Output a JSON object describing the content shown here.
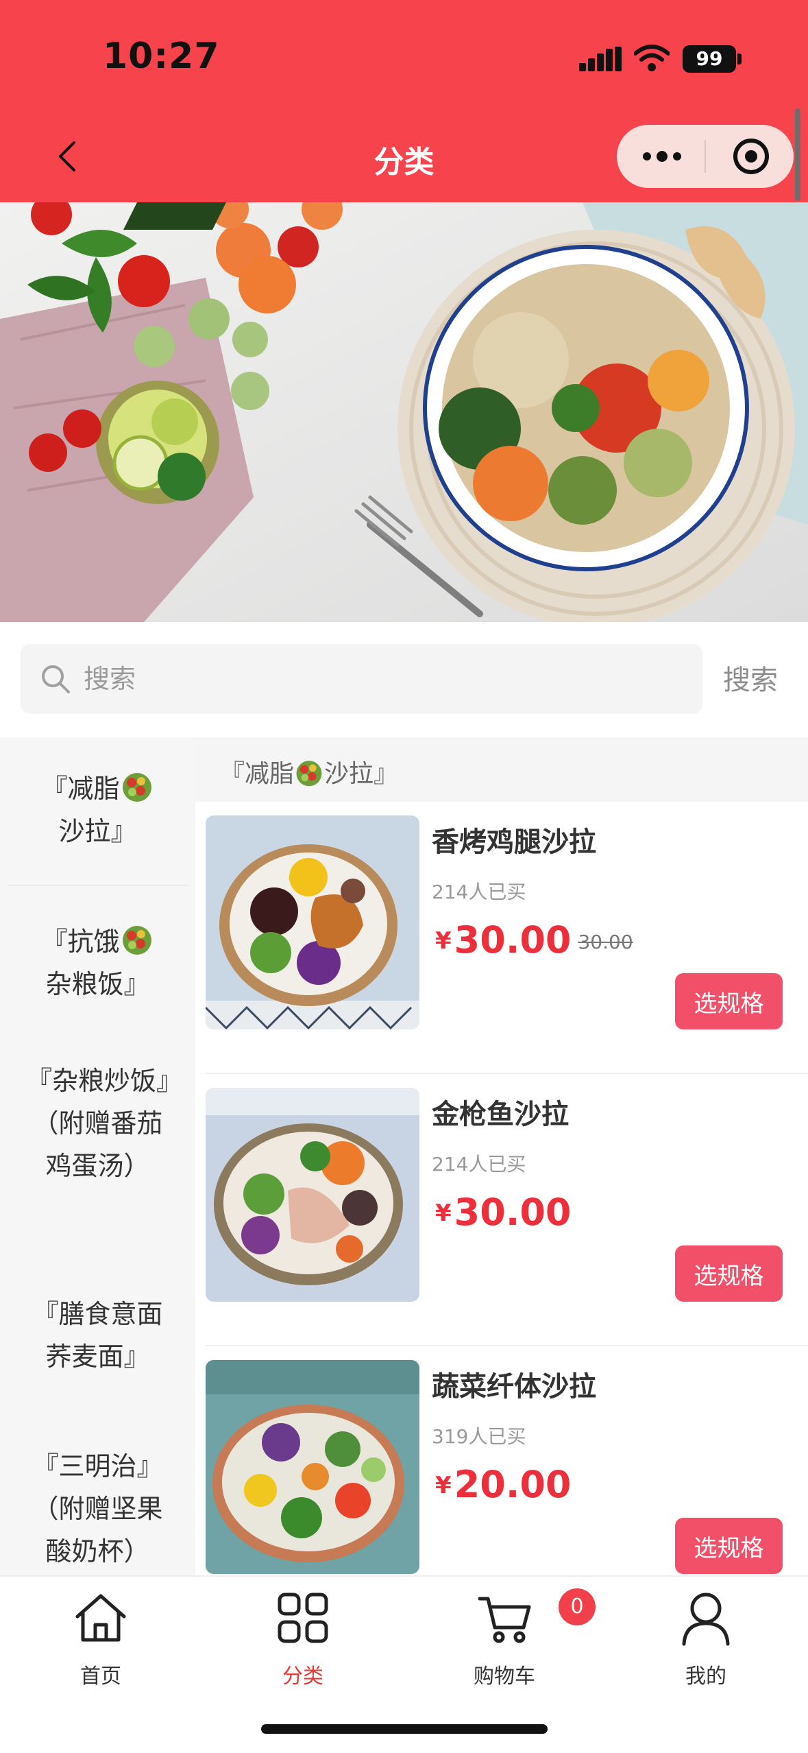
{
  "status": {
    "time": "10:27",
    "battery": "99"
  },
  "nav": {
    "title": "分类"
  },
  "search": {
    "placeholder": "搜索",
    "button": "搜索"
  },
  "categories": [
    {
      "label_a": "『减脂",
      "label_b": "沙拉』",
      "icon": "salad-icon"
    },
    {
      "label_a": "『抗饿",
      "label_b": "杂粮饭』",
      "icon": "salad-icon"
    },
    {
      "label": "『杂粮炒饭』（附赠番茄鸡蛋汤）"
    },
    {
      "label": "『膳食意面荞麦面』"
    },
    {
      "label": "『三明治』（附赠坚果酸奶杯）"
    }
  ],
  "section": {
    "title_a": "『减脂",
    "title_b": "沙拉』"
  },
  "products": [
    {
      "name": "香烤鸡腿沙拉",
      "sold": "214人已买",
      "currency": "¥",
      "price": "30.00",
      "original_price": "30.00",
      "button": "选规格"
    },
    {
      "name": "金枪鱼沙拉",
      "sold": "214人已买",
      "currency": "¥",
      "price": "30.00",
      "button": "选规格"
    },
    {
      "name": "蔬菜纤体沙拉",
      "sold": "319人已买",
      "currency": "¥",
      "price": "20.00",
      "button": "选规格"
    }
  ],
  "tabs": [
    {
      "label": "首页",
      "icon": "home-icon"
    },
    {
      "label": "分类",
      "icon": "category-grid-icon"
    },
    {
      "label": "购物车",
      "icon": "cart-icon"
    },
    {
      "label": "我的",
      "icon": "user-icon"
    }
  ],
  "cart_count": "0",
  "colors": {
    "brand": "#f6434c",
    "price": "#ed2f3b",
    "button": "#f25068",
    "active_tab": "#e43a36"
  }
}
